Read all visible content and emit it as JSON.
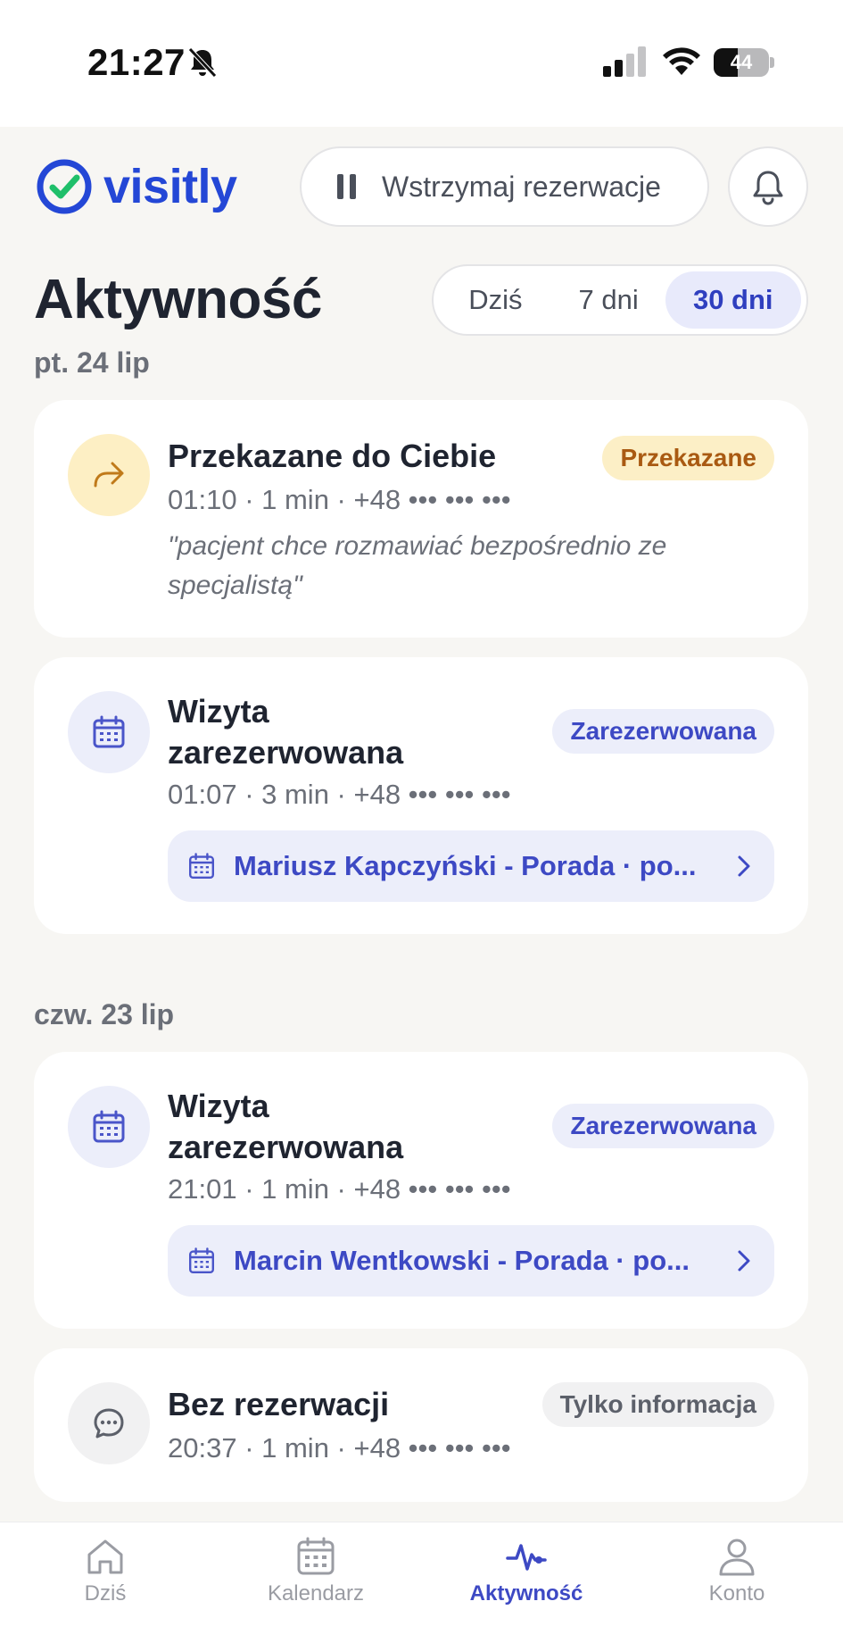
{
  "status_bar": {
    "time": "21:27",
    "battery": "44",
    "battery_level": 0.44
  },
  "header": {
    "logo_text": "visitly",
    "pause_label": "Wstrzymaj rezerwacje"
  },
  "page": {
    "title": "Aktywność",
    "range_options": [
      "Dziś",
      "7 dni",
      "30 dni"
    ],
    "range_selected": "30 dni"
  },
  "groups": [
    {
      "day": "pt. 24 lip",
      "items": [
        {
          "title": "Przekazane do Ciebie",
          "badge": "Przekazane",
          "meta": "01:10 · 1 min · +48 ••• ••• •••",
          "quote": "\"pacjent chce rozmawiać bezpośrednio ze specjalistą\""
        },
        {
          "title_line1": "Wizyta",
          "title_line2": "zarezerwowana",
          "badge": "Zarezerwowana",
          "meta": "01:07 · 3 min · +48 ••• ••• •••",
          "link": "Mariusz Kapczyński - Porada · po..."
        }
      ]
    },
    {
      "day": "czw. 23 lip",
      "items": [
        {
          "title_line1": "Wizyta",
          "title_line2": "zarezerwowana",
          "badge": "Zarezerwowana",
          "meta": "21:01 · 1 min · +48 ••• ••• •••",
          "link": "Marcin Wentkowski - Porada · po..."
        },
        {
          "title": "Bez rezerwacji",
          "badge": "Tylko informacja",
          "meta": "20:37 · 1 min · +48 ••• ••• •••"
        }
      ]
    }
  ],
  "bottom_nav": [
    {
      "label": "Dziś",
      "icon": "home-icon"
    },
    {
      "label": "Kalendarz",
      "icon": "calendar-icon"
    },
    {
      "label": "Aktywność",
      "icon": "activity-icon",
      "active": true
    },
    {
      "label": "Konto",
      "icon": "user-icon"
    }
  ],
  "colors": {
    "brand": "#2447d6",
    "accent": "#3d49c4",
    "amber_badge": "#a95a12"
  }
}
